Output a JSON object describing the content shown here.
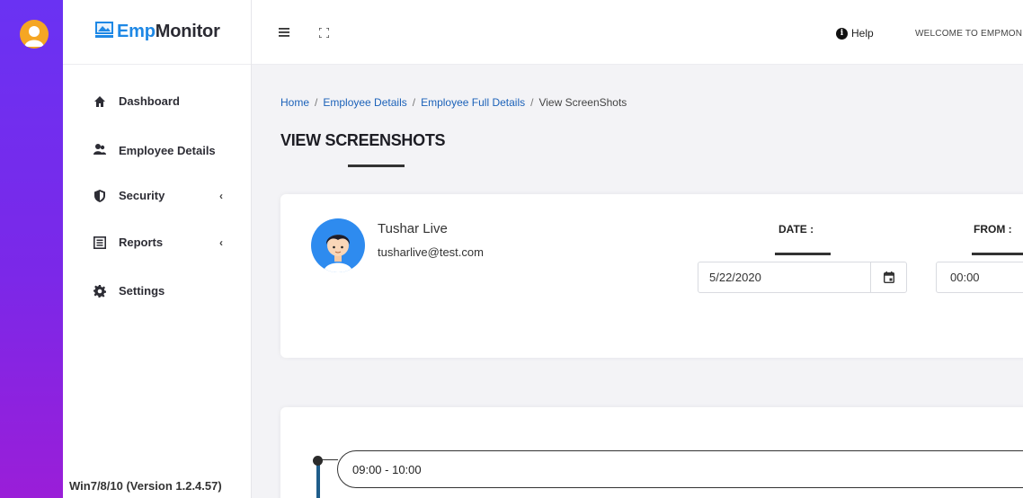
{
  "app": {
    "brand_prefix": "Emp",
    "brand_suffix": "Monitor",
    "version": "Win7/8/10 (Version 1.2.4.57)"
  },
  "sidebar": {
    "items": [
      {
        "label": "Dashboard",
        "icon": "home-icon"
      },
      {
        "label": "Employee Details",
        "icon": "users-icon"
      },
      {
        "label": "Security",
        "icon": "shield-icon",
        "chevron": "‹"
      },
      {
        "label": "Reports",
        "icon": "report-icon",
        "chevron": "‹"
      },
      {
        "label": "Settings",
        "icon": "gear-icon"
      }
    ]
  },
  "header": {
    "help_label": "Help",
    "welcome_text": "WELCOME TO EMPMON"
  },
  "breadcrumb": {
    "items": [
      "Home",
      "Employee Details",
      "Employee Full Details",
      "View ScreenShots"
    ],
    "separator": "/"
  },
  "page": {
    "title": "VIEW SCREENSHOTS"
  },
  "employee": {
    "name": "Tushar Live",
    "email": "tusharlive@test.com"
  },
  "filters": {
    "date_label": "DATE :",
    "date_value": "5/22/2020",
    "from_label": "FROM :",
    "from_value": "00:00"
  },
  "timeline": {
    "slots": [
      "09:00 - 10:00"
    ]
  },
  "colors": {
    "accent": "#1e88e5",
    "link": "#1c62b9",
    "strip_top": "#6a32f3",
    "strip_bottom": "#9a1ed8",
    "timeline": "#1f5d8a"
  }
}
